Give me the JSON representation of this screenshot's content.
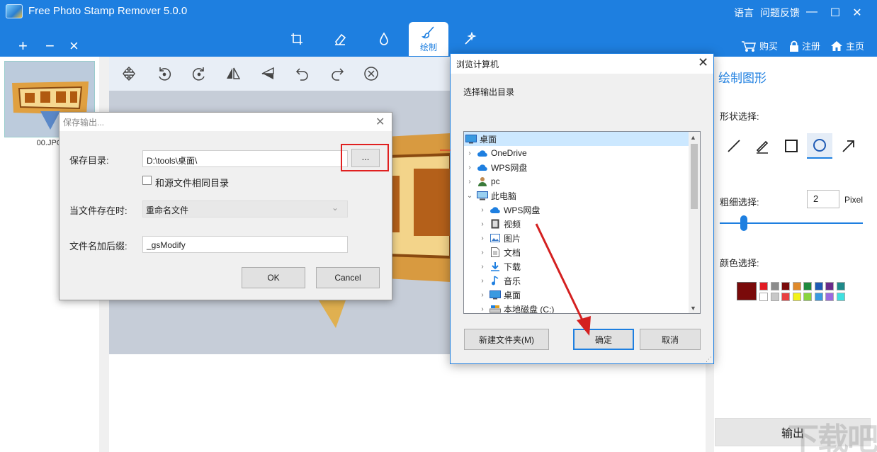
{
  "app": {
    "title": "Free Photo Stamp Remover 5.0.0",
    "lang": "语言",
    "feedback": "问题反馈",
    "buy": "购买",
    "register": "注册",
    "home": "主页",
    "file_buttons": [
      "+",
      "−",
      "×"
    ],
    "modes": [
      {
        "icon": "crop-icon",
        "label": ""
      },
      {
        "icon": "eraser-icon",
        "label": ""
      },
      {
        "icon": "drop-icon",
        "label": ""
      },
      {
        "icon": "brush-icon",
        "label": "绘制",
        "active": true
      },
      {
        "icon": "magic-wand-icon",
        "label": ""
      }
    ],
    "accent": "#1e7fe0"
  },
  "thumbnail": {
    "label": "00.JPG"
  },
  "edit_toolbar": {
    "icons": [
      "move-icon",
      "rotate-ccw-icon",
      "rotate-cw-icon",
      "flip-horizontal-icon",
      "flip-vertical-icon",
      "undo-icon",
      "redo-icon",
      "clear-icon"
    ]
  },
  "right_panel": {
    "title": "绘制图形",
    "shape_label": "形状选择:",
    "thickness_label": "粗细选择:",
    "thickness_value": "2",
    "thickness_unit": "Pixel",
    "color_label": "颜色选择:",
    "current_color": "#7a0a0a",
    "palette_row1": [
      "#e31b23",
      "#8c8c8c",
      "#7a0a0a",
      "#e08a2a",
      "#1e8a3e",
      "#1e5ab4",
      "#6a2a8a",
      "#1e8a8a"
    ],
    "palette_row2": [
      "#ffffff",
      "#c8c8c8",
      "#e84040",
      "#f2f21a",
      "#8ad43e",
      "#3a9ae0",
      "#9a6ae0",
      "#40e0e0"
    ],
    "export": "输出"
  },
  "save_dialog": {
    "title": "保存输出...",
    "dir_label": "保存目录:",
    "dir_value": "D:\\tools\\桌面\\",
    "browse": "...",
    "same_dir": "和源文件相同目录",
    "exists_label": "当文件存在时:",
    "exists_value": "重命名文件",
    "suffix_label": "文件名加后缀:",
    "suffix_value": "_gsModify",
    "ok": "OK",
    "cancel": "Cancel"
  },
  "browse_dialog": {
    "title": "浏览计算机",
    "prompt": "选择输出目录",
    "tree": [
      {
        "label": "桌面",
        "icon": "desktop-icon",
        "level": 0,
        "twisty": "",
        "selected": true
      },
      {
        "label": "OneDrive",
        "icon": "cloud-icon",
        "level": 1,
        "twisty": "›"
      },
      {
        "label": "WPS网盘",
        "icon": "cloud-icon",
        "level": 1,
        "twisty": "›"
      },
      {
        "label": "pc",
        "icon": "user-icon",
        "level": 1,
        "twisty": "›"
      },
      {
        "label": "此电脑",
        "icon": "computer-icon",
        "level": 1,
        "twisty": "⌄"
      },
      {
        "label": "WPS网盘",
        "icon": "cloud-icon",
        "level": 2,
        "twisty": "›"
      },
      {
        "label": "视频",
        "icon": "video-icon",
        "level": 2,
        "twisty": "›"
      },
      {
        "label": "图片",
        "icon": "picture-icon",
        "level": 2,
        "twisty": "›"
      },
      {
        "label": "文档",
        "icon": "document-icon",
        "level": 2,
        "twisty": "›"
      },
      {
        "label": "下载",
        "icon": "download-icon",
        "level": 2,
        "twisty": "›"
      },
      {
        "label": "音乐",
        "icon": "music-icon",
        "level": 2,
        "twisty": "›"
      },
      {
        "label": "桌面",
        "icon": "desktop-icon",
        "level": 2,
        "twisty": "›"
      },
      {
        "label": "本地磁盘 (C:)",
        "icon": "disk-icon",
        "level": 2,
        "twisty": "›"
      }
    ],
    "new_folder": "新建文件夹(M)",
    "ok": "确定",
    "cancel": "取消"
  },
  "watermark": "下载吧"
}
